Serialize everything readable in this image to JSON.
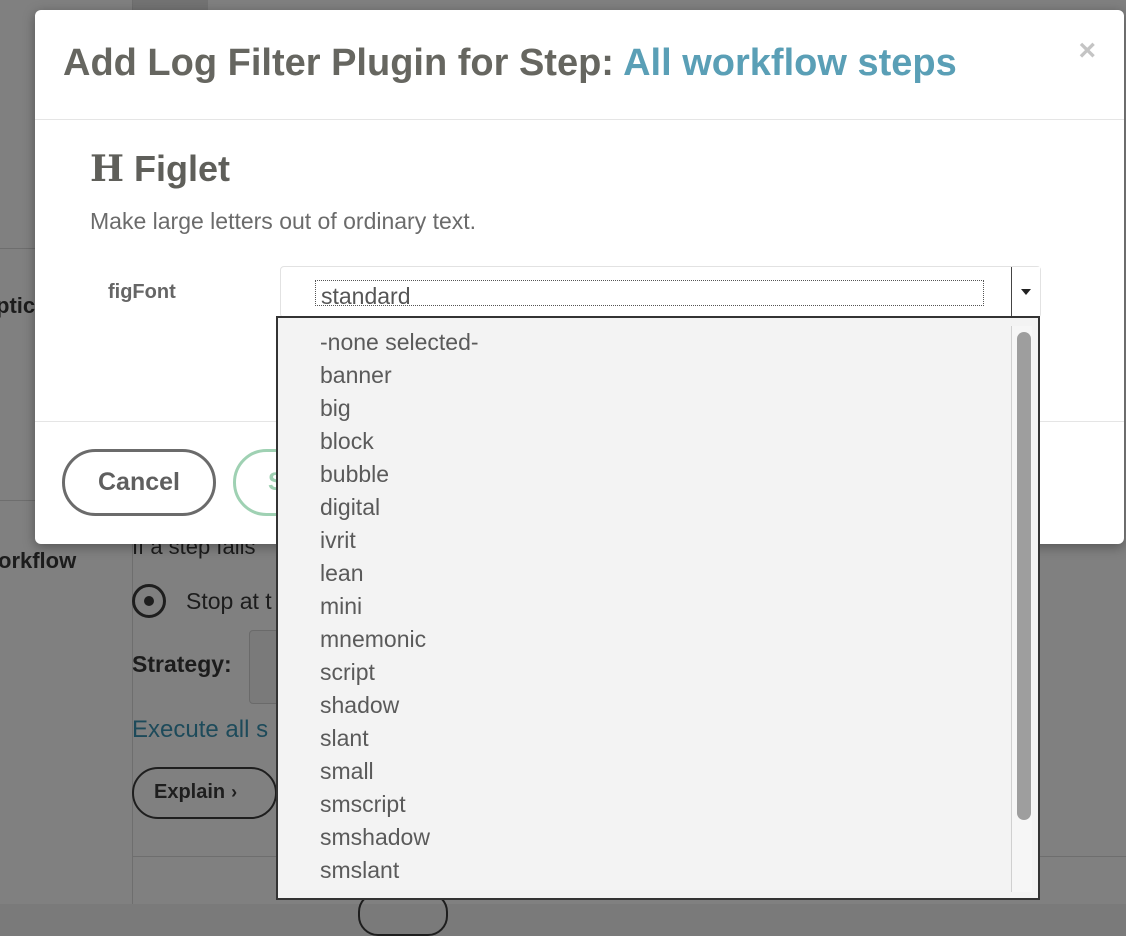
{
  "background": {
    "options_label": "ptic",
    "workflow_label": "orkflow",
    "step_fail_text": "If a step fails",
    "stop_at_text": "Stop at t",
    "strategy_label": "Strategy:",
    "execute_link": "Execute all s",
    "explain_button": "Explain",
    "explain_chevron": "›"
  },
  "modal": {
    "title_prefix": "Add Log Filter Plugin for Step:",
    "title_step": "All workflow steps",
    "close_symbol": "×",
    "plugin": {
      "icon_glyph": "H",
      "name": "Figlet",
      "description": "Make large letters out of ordinary text."
    },
    "field": {
      "label": "figFont",
      "selected_value": "standard"
    },
    "buttons": {
      "cancel": "Cancel",
      "save": "S"
    }
  },
  "dropdown": {
    "options": [
      "-none selected-",
      "banner",
      "big",
      "block",
      "bubble",
      "digital",
      "ivrit",
      "lean",
      "mini",
      "mnemonic",
      "script",
      "shadow",
      "slant",
      "small",
      "smscript",
      "smshadow",
      "smslant"
    ]
  },
  "colors": {
    "accent_step": "#5a9fb6",
    "save_border": "#9fd1b3",
    "overlay": "#808080"
  }
}
